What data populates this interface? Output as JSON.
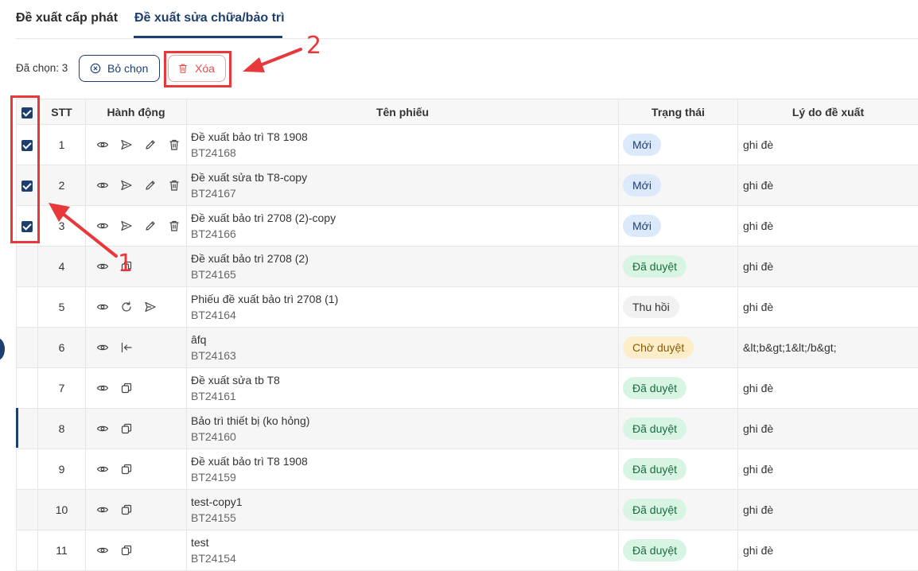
{
  "tabs": [
    {
      "label": "Đề xuất cấp phát",
      "active": false
    },
    {
      "label": "Đề xuất sửa chữa/bảo trì",
      "active": true
    }
  ],
  "toolbar": {
    "selected_label": "Đã chọn: 3",
    "clear_label": "Bỏ chọn",
    "delete_label": "Xóa"
  },
  "table": {
    "headers": {
      "stt": "STT",
      "actions": "Hành động",
      "name": "Tên phiếu",
      "status": "Trạng thái",
      "reason": "Lý do đề xuất"
    },
    "rows": [
      {
        "stt": "1",
        "checked": true,
        "actions": [
          "eye-icon",
          "send-icon",
          "pencil-icon",
          "trash-icon"
        ],
        "name": "Đề xuất bảo trì T8 1908",
        "code": "BT24168",
        "status": "Mới",
        "status_kind": "new",
        "reason": "ghi đè"
      },
      {
        "stt": "2",
        "checked": true,
        "actions": [
          "eye-icon",
          "send-icon",
          "pencil-icon",
          "trash-icon"
        ],
        "name": "Đề xuất sửa tb T8-copy",
        "code": "BT24167",
        "status": "Mới",
        "status_kind": "new",
        "reason": "ghi đè"
      },
      {
        "stt": "3",
        "checked": true,
        "actions": [
          "eye-icon",
          "send-icon",
          "pencil-icon",
          "trash-icon"
        ],
        "name": "Đề xuất bảo trì 2708 (2)-copy",
        "code": "BT24166",
        "status": "Mới",
        "status_kind": "new",
        "reason": "ghi đè"
      },
      {
        "stt": "4",
        "checked": false,
        "actions": [
          "eye-icon",
          "copy-icon"
        ],
        "name": "Đề xuất bảo trì 2708 (2)",
        "code": "BT24165",
        "status": "Đã duyệt",
        "status_kind": "approved",
        "reason": "ghi đè"
      },
      {
        "stt": "5",
        "checked": false,
        "actions": [
          "eye-icon",
          "refresh-icon",
          "send-icon"
        ],
        "name": "Phiếu đề xuất bảo trì 2708 (1)",
        "code": "BT24164",
        "status": "Thu hồi",
        "status_kind": "revoked",
        "reason": "ghi đè"
      },
      {
        "stt": "6",
        "checked": false,
        "actions": [
          "eye-icon",
          "return-icon"
        ],
        "name": "âfq",
        "code": "BT24163",
        "status": "Chờ duyệt",
        "status_kind": "pending",
        "reason": "&lt;b&gt;1&lt;/b&gt;"
      },
      {
        "stt": "7",
        "checked": false,
        "actions": [
          "eye-icon",
          "copy-icon"
        ],
        "name": "Đề xuất sửa tb T8",
        "code": "BT24161",
        "status": "Đã duyệt",
        "status_kind": "approved",
        "reason": "ghi đè"
      },
      {
        "stt": "8",
        "checked": false,
        "actions": [
          "eye-icon",
          "copy-icon"
        ],
        "name": "Bảo trì thiết bị (ko hỏng)",
        "code": "BT24160",
        "status": "Đã duyệt",
        "status_kind": "approved",
        "reason": "ghi đè"
      },
      {
        "stt": "9",
        "checked": false,
        "actions": [
          "eye-icon",
          "copy-icon"
        ],
        "name": "Đề xuất bảo trì T8 1908",
        "code": "BT24159",
        "status": "Đã duyệt",
        "status_kind": "approved",
        "reason": "ghi đè"
      },
      {
        "stt": "10",
        "checked": false,
        "actions": [
          "eye-icon",
          "copy-icon"
        ],
        "name": "test-copy1",
        "code": "BT24155",
        "status": "Đã duyệt",
        "status_kind": "approved",
        "reason": "ghi đè"
      },
      {
        "stt": "11",
        "checked": false,
        "actions": [
          "eye-icon",
          "copy-icon"
        ],
        "name": "test",
        "code": "BT24154",
        "status": "Đã duyệt",
        "status_kind": "approved",
        "reason": "ghi đè"
      }
    ]
  },
  "annotations": {
    "label_1": "1",
    "label_2": "2"
  },
  "colors": {
    "primary": "#1d3e6e",
    "danger": "#e05050",
    "annotation": "#e8383b",
    "status_new_bg": "#dbe9fb",
    "status_new_fg": "#1d3e6e",
    "status_approved_bg": "#d8f5e3",
    "status_approved_fg": "#1c6b3e",
    "status_revoked_bg": "#f1f1f1",
    "status_revoked_fg": "#333333",
    "status_pending_bg": "#fdedc8",
    "status_pending_fg": "#8a5a00"
  }
}
